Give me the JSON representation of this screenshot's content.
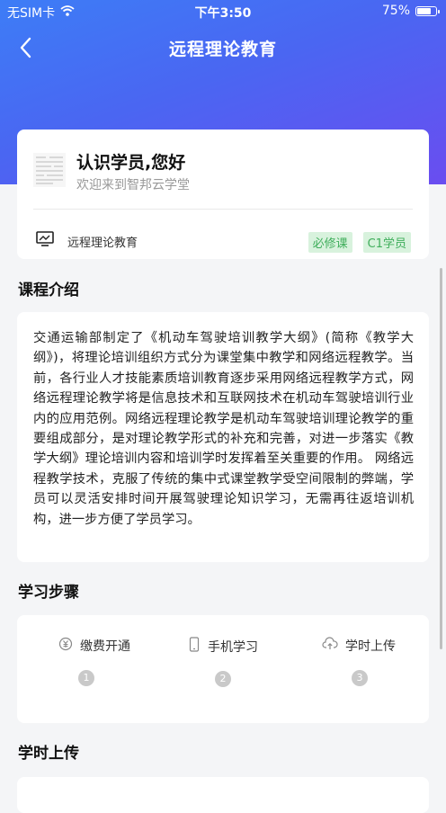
{
  "status_bar": {
    "carrier": "无SIM卡",
    "time": "下午3:50",
    "battery": "75%"
  },
  "nav": {
    "title": "远程理论教育"
  },
  "profile": {
    "greeting": "认识学员,您好",
    "welcome": "欢迎来到智邦云学堂",
    "course_name": "远程理论教育",
    "tags": [
      "必修课",
      "C1学员"
    ]
  },
  "intro": {
    "title": "课程介绍",
    "text": "交通运输部制定了《机动车驾驶培训教学大纲》(简称《教学大纲》)，将理论培训组织方式分为课堂集中教学和网络远程教学。当前，各行业人才技能素质培训教育逐步采用网络远程教学方式，网络远程理论教学将是信息技术和互联网技术在机动车驾驶培训行业内的应用范例。网络远程理论教学是机动车驾驶培训理论教学的重要组成部分，是对理论教学形式的补充和完善，对进一步落实《教学大纲》理论培训内容和培训学时发挥着至关重要的作用。 网络远程教学技术，克服了传统的集中式课堂教学受空间限制的弊端，学员可以灵活安排时间开展驾驶理论知识学习，无需再往返培训机构，进一步方便了学员学习。"
  },
  "steps": {
    "title": "学习步骤",
    "items": [
      {
        "label": "缴费开通",
        "num": "1",
        "icon": "payment-icon"
      },
      {
        "label": "手机学习",
        "num": "2",
        "icon": "phone-icon"
      },
      {
        "label": "学时上传",
        "num": "3",
        "icon": "cloud-upload-icon"
      }
    ]
  },
  "upload": {
    "title": "学时上传"
  },
  "colors": {
    "header_start": "#3d7df6",
    "header_end": "#6a4df0",
    "tag_bg": "#d8f2dd",
    "tag_text": "#3fae5b"
  }
}
